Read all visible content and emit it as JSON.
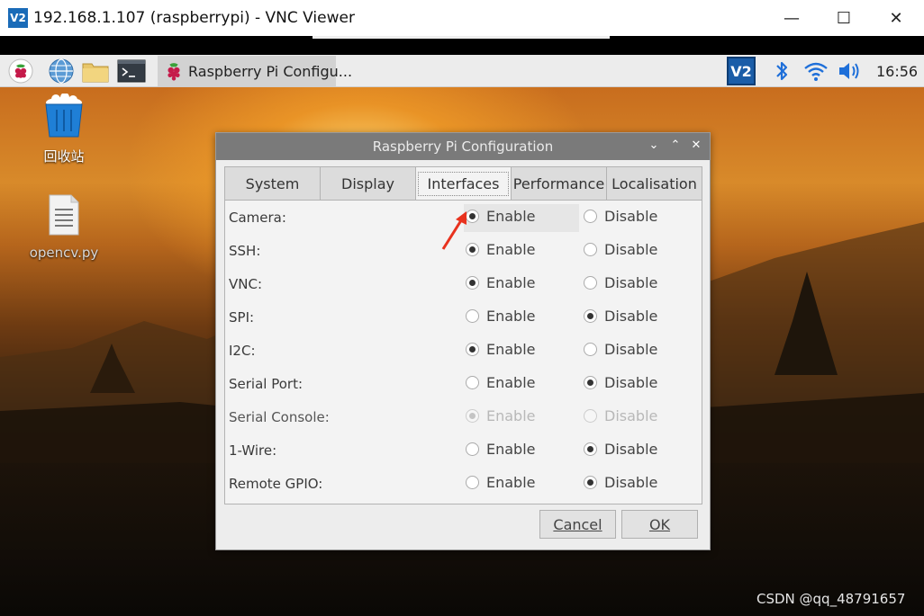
{
  "vnc_window": {
    "logo_text": "V2",
    "title": "192.168.1.107 (raspberrypi) - VNC Viewer",
    "controls": {
      "minimize": "—",
      "maximize": "☐",
      "close": "✕"
    }
  },
  "taskbar": {
    "launchers": [
      {
        "name": "raspberry-menu-icon"
      },
      {
        "name": "web-browser-icon"
      },
      {
        "name": "file-manager-icon"
      },
      {
        "name": "terminal-icon"
      }
    ],
    "task_label": "Raspberry Pi Configu...",
    "tray": {
      "vnc_logo": "V2",
      "clock": "16:56"
    },
    "colors": {
      "bluetooth": "#1e6fd9",
      "wifi": "#1e6fd9",
      "volume": "#1e6fd9"
    }
  },
  "desktop": {
    "icons": [
      {
        "label": "回收站",
        "icon": "trash-icon"
      },
      {
        "label": "opencv.py",
        "icon": "text-file-icon"
      }
    ]
  },
  "dialog": {
    "title": "Raspberry Pi Configuration",
    "tabs": [
      {
        "label": "System"
      },
      {
        "label": "Display"
      },
      {
        "label": "Interfaces",
        "active": true
      },
      {
        "label": "Performance"
      },
      {
        "label": "Localisation"
      }
    ],
    "enable_label": "Enable",
    "disable_label": "Disable",
    "rows": [
      {
        "label": "Camera:",
        "selected": "Enable"
      },
      {
        "label": "SSH:",
        "selected": "Enable"
      },
      {
        "label": "VNC:",
        "selected": "Enable"
      },
      {
        "label": "SPI:",
        "selected": "Disable"
      },
      {
        "label": "I2C:",
        "selected": "Enable"
      },
      {
        "label": "Serial Port:",
        "selected": "Disable"
      },
      {
        "label": "Serial Console:",
        "selected": "Enable",
        "disabled": true
      },
      {
        "label": "1-Wire:",
        "selected": "Disable"
      },
      {
        "label": "Remote GPIO:",
        "selected": "Disable"
      }
    ],
    "buttons": {
      "cancel": "Cancel",
      "ok": "OK"
    }
  },
  "watermark": "CSDN @qq_48791657",
  "annotation_color": "#e8321e"
}
